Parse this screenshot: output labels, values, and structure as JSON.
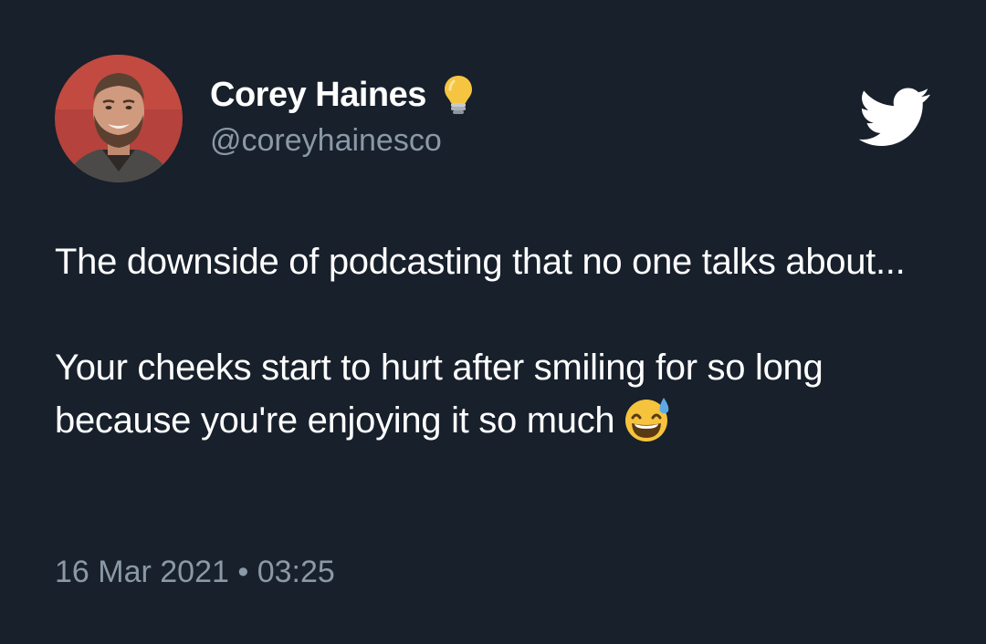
{
  "author": {
    "display_name": "Corey Haines",
    "handle": "@coreyhainesco",
    "name_badge_icon": "lightbulb-icon",
    "avatar_icon": "profile-photo"
  },
  "platform_icon": "twitter-bird-icon",
  "tweet": {
    "paragraph_1": "The downside of podcasting that no one talks about...",
    "paragraph_2": "Your cheeks start to hurt after smiling for so long because you're enjoying it so much",
    "emoji_icon": "grinning-face-with-sweat-emoji"
  },
  "timestamp": {
    "date": "16 Mar 2021",
    "separator": "•",
    "time": "03:25"
  },
  "colors": {
    "background": "#17202b",
    "primary_text": "#ffffff",
    "secondary_text": "#8b98a5"
  }
}
